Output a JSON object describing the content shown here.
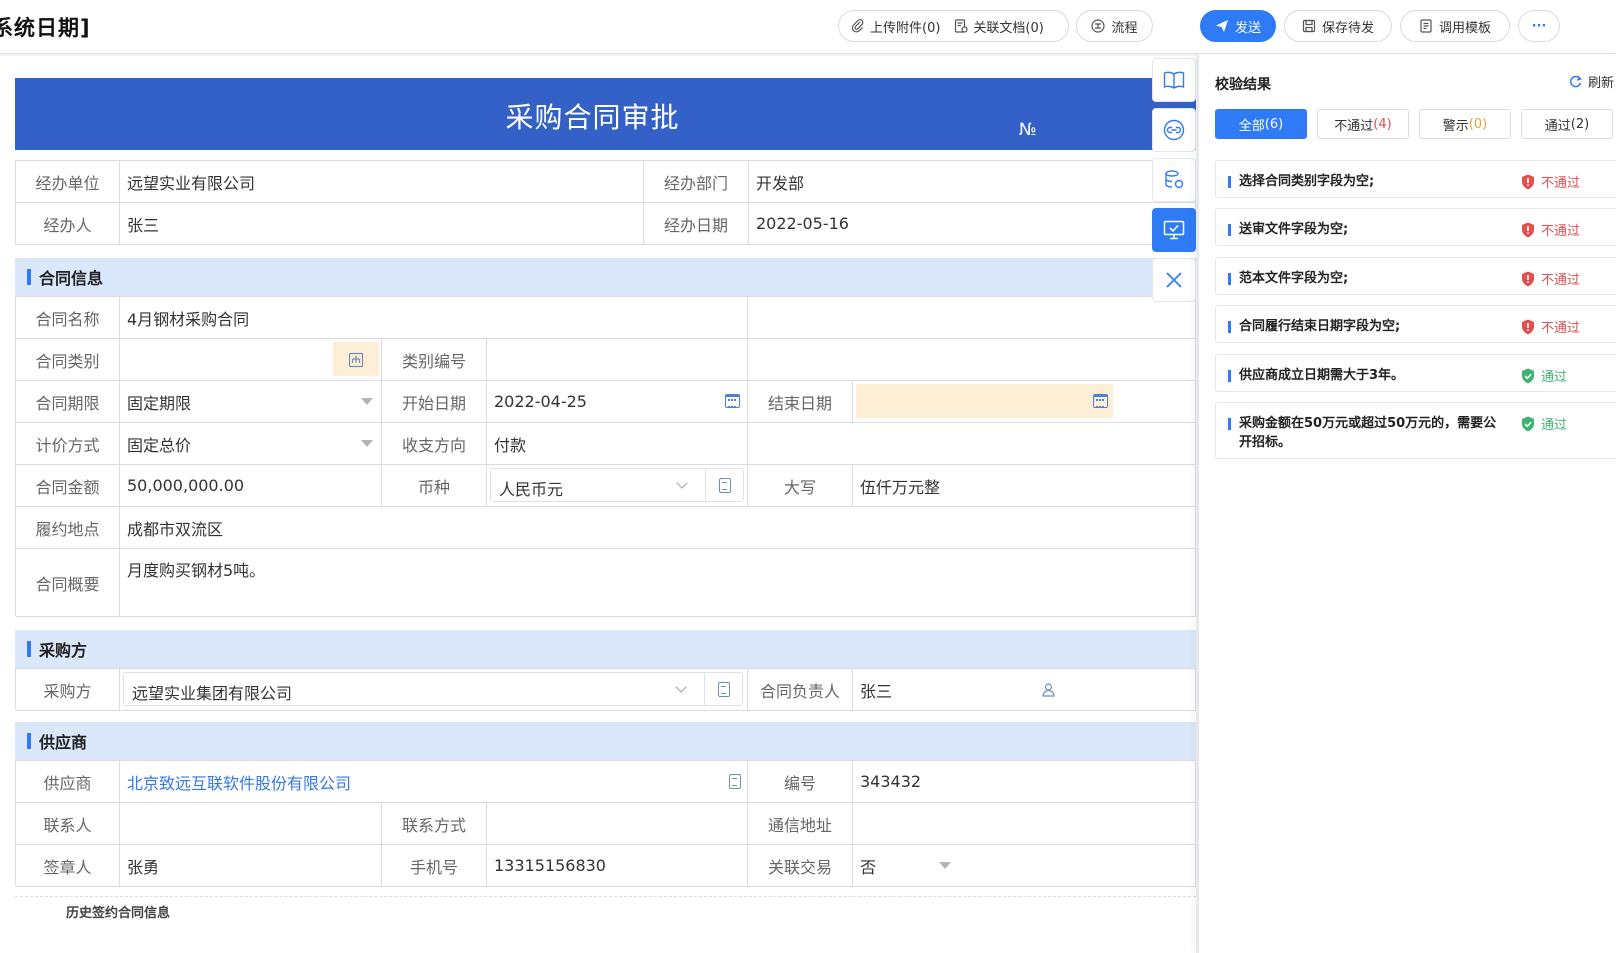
{
  "header": {
    "title": "系统日期]",
    "upload_label": "上传附件(0)",
    "related_docs_label": "关联文档(0)",
    "flow_label": "流程",
    "send_label": "发送",
    "save_label": "保存待发",
    "template_label": "调用模板",
    "more_label": "···"
  },
  "form": {
    "title": "采购合同审批",
    "number_label": "№",
    "handler_unit_label": "经办单位",
    "handler_unit": "远望实业有限公司",
    "handler_dept_label": "经办部门",
    "handler_dept": "开发部",
    "handler_label": "经办人",
    "handler": "张三",
    "handle_date_label": "经办日期",
    "handle_date": "2022-05-16",
    "contract_section": "合同信息",
    "contract_name_label": "合同名称",
    "contract_name": "4月钢材采购合同",
    "contract_type_label": "合同类别",
    "type_code_label": "类别编号",
    "term_label": "合同期限",
    "term_value": "固定期限",
    "start_date_label": "开始日期",
    "start_date": "2022-04-25",
    "end_date_label": "结束日期",
    "pricing_label": "计价方式",
    "pricing_value": "固定总价",
    "direction_label": "收支方向",
    "direction_value": "付款",
    "amount_label": "合同金额",
    "amount_value": "50,000,000.00",
    "currency_label": "币种",
    "currency_value": "人民币元",
    "uppercase_label": "大写",
    "uppercase_value": "伍仟万元整",
    "location_label": "履约地点",
    "location_value": "成都市双流区",
    "summary_label": "合同概要",
    "summary_value": "月度购买钢材5吨。",
    "purchaser_section": "采购方",
    "purchaser_label": "采购方",
    "purchaser_value": "远望实业集团有限公司",
    "owner_label": "合同负责人",
    "owner_value": "张三",
    "supplier_section": "供应商",
    "supplier_label": "供应商",
    "supplier_value": "北京致远互联软件股份有限公司",
    "code_label": "编号",
    "code_value": "343432",
    "contact_label": "联系人",
    "contact_method_label": "联系方式",
    "address_label": "通信地址",
    "signer_label": "签章人",
    "signer_value": "张勇",
    "phone_label": "手机号",
    "phone_value": "13315156830",
    "related_trade_label": "关联交易",
    "related_trade_value": "否",
    "history_label": "历史签约合同信息"
  },
  "panel": {
    "title": "校验结果",
    "refresh_label": "刷新",
    "filters": [
      {
        "label": "全部",
        "count": "(6)"
      },
      {
        "label": "不通过",
        "count": "(4)"
      },
      {
        "label": "警示",
        "count": "(0)"
      },
      {
        "label": "通过",
        "count": "(2)"
      }
    ],
    "items": [
      {
        "message": "选择合同类别字段为空;",
        "status": "不通过"
      },
      {
        "message": "送审文件字段为空;",
        "status": "不通过"
      },
      {
        "message": "范本文件字段为空;",
        "status": "不通过"
      },
      {
        "message": "合同履行结束日期字段为空;",
        "status": "不通过"
      },
      {
        "message": "供应商成立日期需大于3年。",
        "status": "通过"
      },
      {
        "message": "采购金额在50万元或超过50万元的，需要公开招标。",
        "status": "通过"
      }
    ]
  },
  "colors": {
    "primary": "#2f7bf5",
    "banner": "#3461c8",
    "fail": "#e05050",
    "pass": "#3cb371",
    "section_bg": "#dbe8fb"
  }
}
